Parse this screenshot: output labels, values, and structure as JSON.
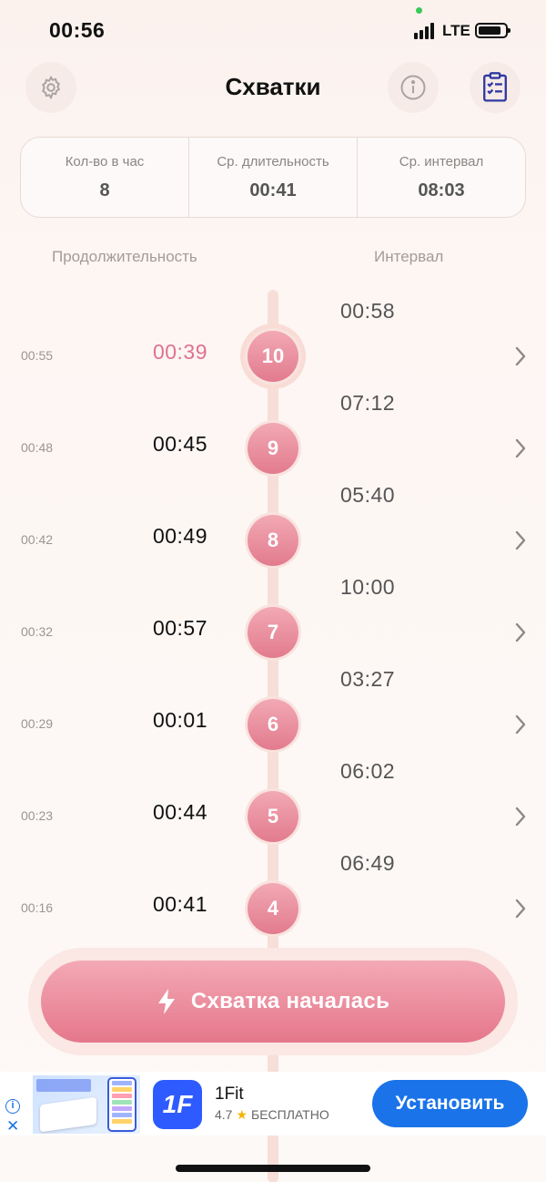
{
  "status_bar": {
    "time": "00:56",
    "network": "LTE"
  },
  "header": {
    "title": "Схватки"
  },
  "stats": [
    {
      "label": "Кол-во в час",
      "value": "8"
    },
    {
      "label": "Ср. длительность",
      "value": "00:41"
    },
    {
      "label": "Ср. интервал",
      "value": "08:03"
    }
  ],
  "columns": {
    "duration": "Продолжительность",
    "interval": "Интервал"
  },
  "rows": [
    {
      "start": "00:55",
      "duration": "00:39",
      "number": "10",
      "interval_before": "00:58"
    },
    {
      "start": "00:48",
      "duration": "00:45",
      "number": "9",
      "interval_before": "07:12"
    },
    {
      "start": "00:42",
      "duration": "00:49",
      "number": "8",
      "interval_before": "05:40"
    },
    {
      "start": "00:32",
      "duration": "00:57",
      "number": "7",
      "interval_before": "10:00"
    },
    {
      "start": "00:29",
      "duration": "00:01",
      "number": "6",
      "interval_before": "03:27"
    },
    {
      "start": "00:23",
      "duration": "00:44",
      "number": "5",
      "interval_before": "06:02"
    },
    {
      "start": "00:16",
      "duration": "00:41",
      "number": "4",
      "interval_before": "06:49"
    }
  ],
  "main_button": {
    "label": "Схватка началась"
  },
  "ad": {
    "app_name": "1Fit",
    "logo_text": "1F",
    "rating": "4.7",
    "price": "БЕСПЛАТНО",
    "install_label": "Установить"
  },
  "colors": {
    "accent": "#e27b8e",
    "active_duration": "#e0728c",
    "install": "#1a73e8"
  }
}
